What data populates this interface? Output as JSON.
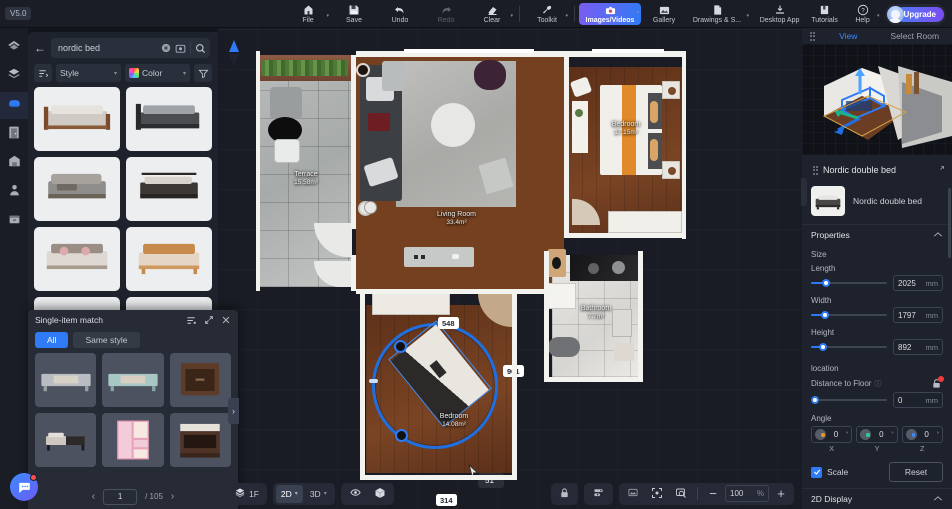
{
  "app": {
    "version_badge": "V5.0"
  },
  "toolbar": {
    "items": [
      {
        "label": "File",
        "icon": "file-home-icon",
        "caret": true,
        "dim": false,
        "active": false
      },
      {
        "label": "Save",
        "icon": "save-icon",
        "caret": false,
        "dim": false,
        "active": false
      },
      {
        "label": "Undo",
        "icon": "undo-icon",
        "caret": false,
        "dim": false,
        "active": false
      },
      {
        "label": "Redo",
        "icon": "redo-icon",
        "caret": false,
        "dim": true,
        "active": false
      },
      {
        "label": "Clear",
        "icon": "eraser-icon",
        "caret": true,
        "dim": false,
        "active": false
      },
      {
        "label": "Toolkit",
        "icon": "wrench-icon",
        "caret": true,
        "dim": false,
        "active": false
      },
      {
        "label": "Images/Videos",
        "icon": "camera-icon",
        "caret": true,
        "dim": false,
        "active": true
      },
      {
        "label": "Gallery",
        "icon": "gallery-icon",
        "caret": false,
        "dim": false,
        "active": false
      },
      {
        "label": "Drawings & S...",
        "icon": "document-icon",
        "caret": true,
        "dim": false,
        "active": false
      }
    ],
    "right": [
      {
        "label": "Desktop App",
        "icon": "download-icon"
      },
      {
        "label": "Tutorials",
        "icon": "book-icon"
      },
      {
        "label": "Help",
        "icon": "question-icon",
        "caret": true
      }
    ],
    "upgrade_label": "Upgrade"
  },
  "rail": {
    "items": [
      {
        "name": "sidebar-item-structure",
        "icon": "roof-icon",
        "selected": false
      },
      {
        "name": "sidebar-item-layers",
        "icon": "layers-icon",
        "selected": false
      },
      {
        "name": "sidebar-item-furniture",
        "icon": "furniture-icon",
        "selected": true
      },
      {
        "name": "sidebar-item-doors",
        "icon": "door-icon",
        "selected": false
      },
      {
        "name": "sidebar-item-building",
        "icon": "house-icon",
        "selected": false
      },
      {
        "name": "sidebar-item-people",
        "icon": "person-icon",
        "selected": false
      },
      {
        "name": "sidebar-item-appliances",
        "icon": "appliance-icon",
        "selected": false
      }
    ]
  },
  "library": {
    "search": {
      "query": "nordic bed",
      "placeholder": "Search"
    },
    "filters": {
      "sort_icon": "sort-icon",
      "style_label": "Style",
      "color_label": "Color",
      "funnel_icon": "filter-icon"
    },
    "cards": [
      {
        "name": "wood-frame-bed",
        "body": "#cfcac3",
        "frame": "#7b4a2c"
      },
      {
        "name": "black-metal-bed",
        "body": "#4a4c50",
        "frame": "#2b2c30"
      },
      {
        "name": "grey-upholstered-bed",
        "body": "#8f8d8b",
        "frame": "#6b6257"
      },
      {
        "name": "dark-duvet-bed",
        "body": "#3c3836",
        "frame": "#272322"
      },
      {
        "name": "pink-pillow-bed",
        "body": "#ded7d2",
        "frame": "#9a8d84"
      },
      {
        "name": "tan-leather-bed",
        "body": "#e5d5c4",
        "frame": "#c78a4c"
      },
      {
        "name": "cream-bed",
        "body": "#e2dcd4",
        "frame": "#b5a898"
      },
      {
        "name": "light-wood-bed",
        "body": "#ded6cb",
        "frame": "#c0a078"
      }
    ]
  },
  "match_panel": {
    "title": "Single-item match",
    "header_icons": [
      "list-settings-icon",
      "expand-icon",
      "close-icon"
    ],
    "tabs": [
      {
        "label": "All",
        "active": true
      },
      {
        "label": "Same style",
        "active": false
      }
    ],
    "results": [
      {
        "name": "grey-tv-console",
        "tone": "#b9bdc2"
      },
      {
        "name": "mint-tv-console",
        "tone": "#a8c7c4"
      },
      {
        "name": "dark-wood-nightstand",
        "tone": "#5d3c2a"
      },
      {
        "name": "black-white-bed",
        "tone": "#cfc7c0"
      },
      {
        "name": "pink-wardrobe",
        "tone": "#e8a4bd"
      },
      {
        "name": "walnut-open-nightstand",
        "tone": "#4e3326"
      }
    ],
    "next_arrow": "chevron-right-icon",
    "pagination": {
      "prev": "chevron-left-icon",
      "current": "1",
      "total": "/ 105",
      "next": "chevron-right-icon"
    }
  },
  "canvas": {
    "compass_icon": "north-compass-icon",
    "rooms": [
      {
        "name": "Terrace",
        "area": "15.58m²"
      },
      {
        "name": "Living Room",
        "area": "33.4m²"
      },
      {
        "name": "Bedroom",
        "area": "17.15m²"
      },
      {
        "name": "Bathroom",
        "area": "7.7m²"
      },
      {
        "name": "Bedroom",
        "area": "14.08m²"
      }
    ],
    "selection": {
      "dimension_top": "548",
      "dimension_right": "901",
      "dimension_bottom": "314",
      "angle_tooltip": "51°",
      "accent_color": "#2f7bf5"
    }
  },
  "bottombar": {
    "floor_label": "1F",
    "floor_icon": "layers-icon",
    "view_modes": [
      {
        "label": "2D",
        "active": true,
        "caret": true
      },
      {
        "label": "3D",
        "active": false,
        "caret": true
      }
    ],
    "toggles": [
      {
        "name": "visibility-toggle",
        "icon": "eye-icon"
      },
      {
        "name": "box-render-toggle",
        "icon": "cube-icon"
      }
    ],
    "right_tools": [
      {
        "name": "lock-button",
        "icon": "lock-icon"
      },
      {
        "name": "align-button",
        "icon": "align-icon"
      },
      {
        "name": "image-button",
        "icon": "picture-icon"
      },
      {
        "name": "fit-button",
        "icon": "focus-icon"
      },
      {
        "name": "inspect-button",
        "icon": "magnifier-screen-icon"
      }
    ],
    "zoom": {
      "minus": "−",
      "value": "100",
      "unit": "%",
      "plus": "+"
    }
  },
  "right_panel": {
    "view_tabs": [
      {
        "label": "View",
        "active": true
      },
      {
        "label": "Select Room",
        "active": false
      }
    ],
    "object_title": "Nordic double bed",
    "object_name": "Nordic double bed",
    "expand_icon": "expand-diagonal-icon",
    "sections": {
      "properties": {
        "label": "Properties",
        "collapse_icon": "chevron-up-icon",
        "size_label": "Size",
        "fields": [
          {
            "label": "Length",
            "value": "2025",
            "unit": "mm",
            "fill": 18
          },
          {
            "label": "Width",
            "value": "1797",
            "unit": "mm",
            "fill": 16
          },
          {
            "label": "Height",
            "value": "892",
            "unit": "mm",
            "fill": 14
          }
        ],
        "location_label": "location",
        "distance_label": "Distance to Floor",
        "distance_value": "0",
        "distance_unit": "mm",
        "distance_fill": 0,
        "lock_icon": "lock-icon",
        "angle_label": "Angle",
        "angles": [
          {
            "axis": "X",
            "value": "0",
            "unit": "°",
            "color": "#e8922e"
          },
          {
            "axis": "Y",
            "value": "0",
            "unit": "°",
            "color": "#2ecf8f"
          },
          {
            "axis": "Z",
            "value": "0",
            "unit": "°",
            "color": "#3d8bff"
          }
        ],
        "scale_label": "Scale",
        "scale_checked": true,
        "reset_label": "Reset"
      },
      "display": {
        "label": "2D Display",
        "collapse_icon": "chevron-up-icon"
      }
    }
  }
}
